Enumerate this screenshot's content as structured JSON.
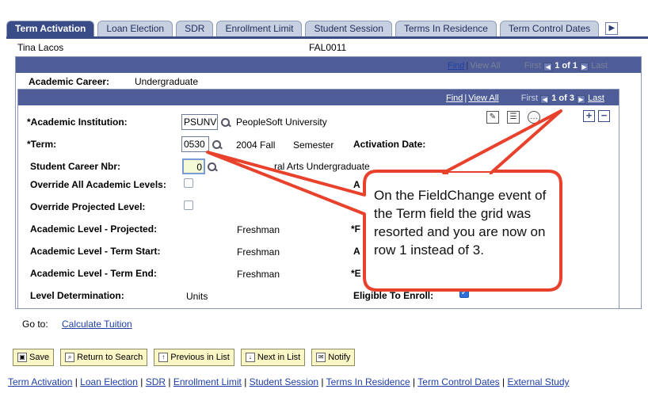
{
  "tabs": [
    {
      "label": "Term Activation",
      "active": true
    },
    {
      "label": "Loan Election",
      "active": false
    },
    {
      "label": "SDR",
      "active": false
    },
    {
      "label": "Enrollment Limit",
      "active": false
    },
    {
      "label": "Student Session",
      "active": false
    },
    {
      "label": "Terms In Residence",
      "active": false
    },
    {
      "label": "Term Control Dates",
      "active": false
    }
  ],
  "tab_more_icon": "right-arrow",
  "header": {
    "name": "Tina Lacos",
    "id": "FAL0011"
  },
  "outer_nav": {
    "find": "Find",
    "view_all": "View All",
    "first": "First",
    "count": "1 of 1",
    "last": "Last"
  },
  "career": {
    "label": "Academic Career:",
    "value": "Undergraduate"
  },
  "inner_nav": {
    "find": "Find",
    "view_all": "View All",
    "first": "First",
    "count": "1 of 3",
    "last": "Last"
  },
  "fields": {
    "institution_label": "*Academic Institution:",
    "institution_value": "PSUNV",
    "institution_desc": "PeopleSoft University",
    "term_label": "*Term:",
    "term_value": "0530",
    "term_desc": "2004 Fall",
    "term_type": "Semester",
    "activation_label": "Activation Date:",
    "career_nbr_label": "Student Career Nbr:",
    "career_nbr_value": "0",
    "career_nbr_desc": "ral Arts Undergraduate",
    "override_all_label": "Override All Academic Levels:",
    "override_proj_label": "Override Projected Level:",
    "level_proj_label": "Academic Level - Projected:",
    "level_proj_value": "Freshman",
    "level_start_label": "Academic Level - Term Start:",
    "level_start_value": "Freshman",
    "level_end_label": "Academic Level - Term End:",
    "level_end_value": "Freshman",
    "level_det_label": "Level Determination:",
    "level_det_value": "Units",
    "eligible_label": "Eligible To Enroll:",
    "partial_a1": "A",
    "partial_p": "*F",
    "partial_a2": "A",
    "partial_b": "*E"
  },
  "goto": {
    "label": "Go to:",
    "link": "Calculate Tuition"
  },
  "buttons": [
    {
      "label": "Save"
    },
    {
      "label": "Return to Search"
    },
    {
      "label": "Previous in List"
    },
    {
      "label": "Next in List"
    },
    {
      "label": "Notify"
    }
  ],
  "footer_links": [
    "Term Activation",
    "Loan Election",
    "SDR",
    "Enrollment Limit",
    "Student Session",
    "Terms In Residence",
    "Term Control Dates",
    "External Study"
  ],
  "callout": {
    "text": "On the FieldChange event of the Term field the grid was resorted and you are now on row 1 instead of 3."
  },
  "colors": {
    "tab_active": "#3a4c88",
    "bar": "#4e5d97",
    "callout_border": "#e8412c",
    "button_bg": "#fbf6c6"
  }
}
